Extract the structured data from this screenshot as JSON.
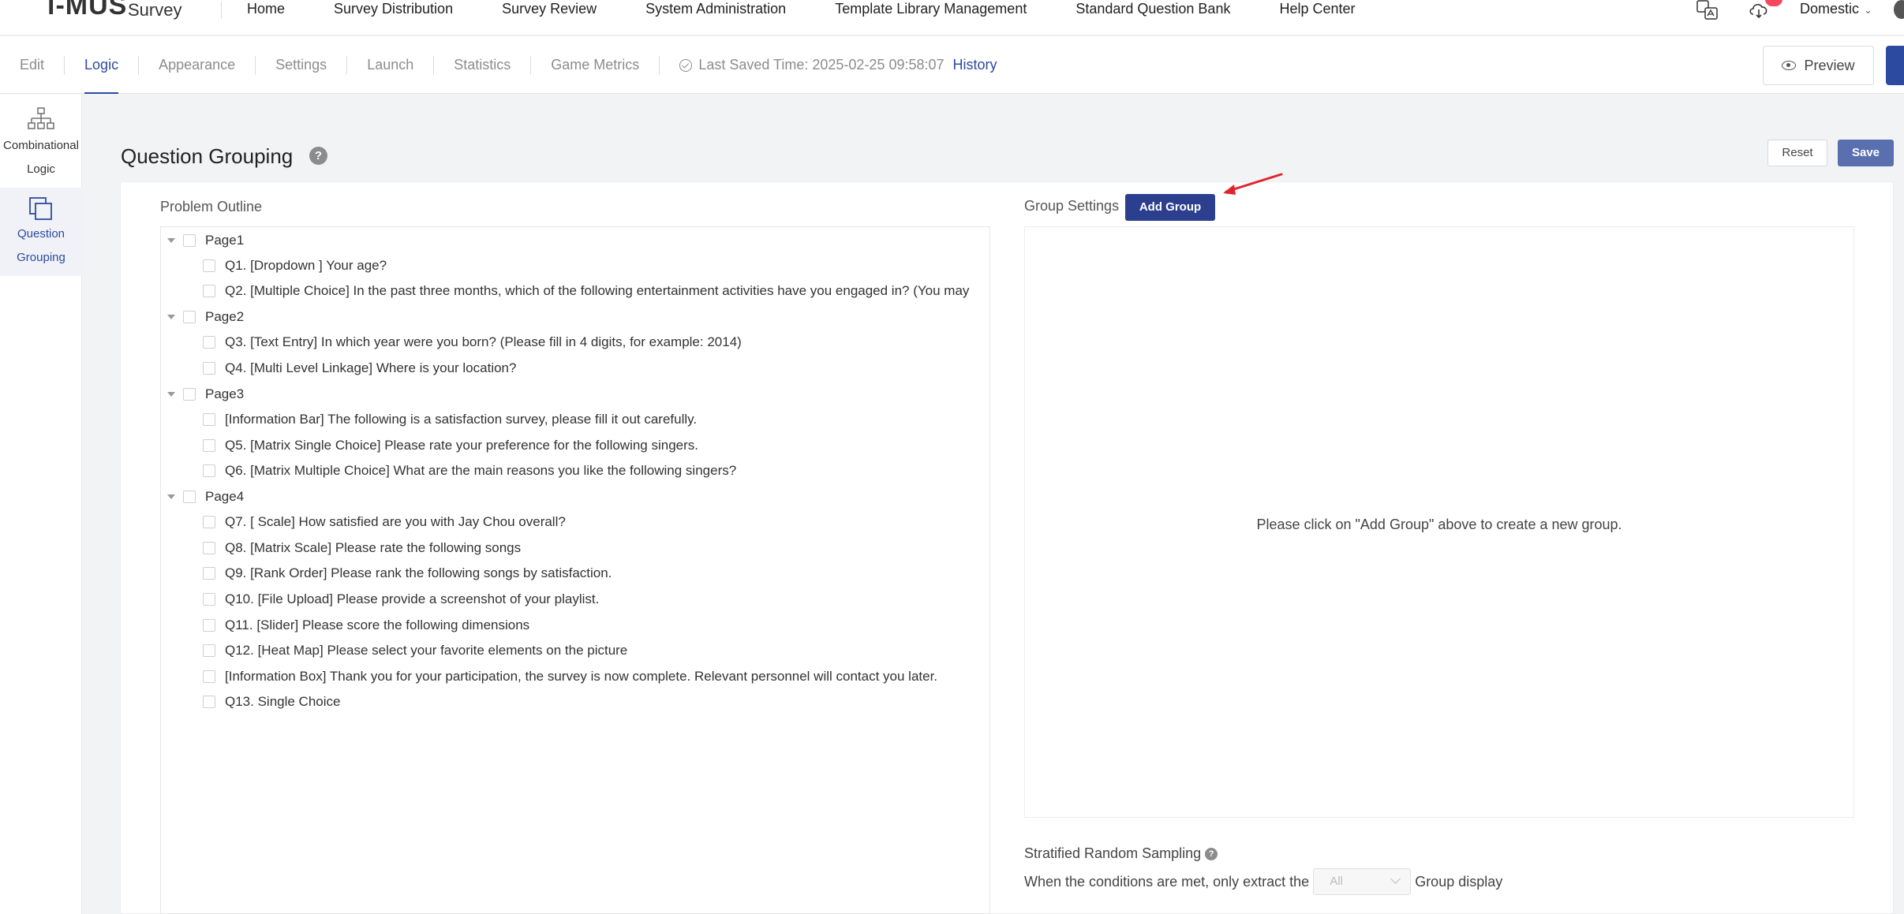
{
  "header": {
    "logo_text": "i-MUS",
    "logo_sub": "Survey",
    "nav": [
      "Home",
      "Survey Distribution",
      "Survey Review",
      "System Administration",
      "Template Library Management",
      "Standard Question Bank",
      "Help Center"
    ],
    "region": "Domestic",
    "icons": [
      "translate-icon",
      "cloud-download-icon",
      "user-avatar"
    ]
  },
  "subnav": {
    "tabs": [
      "Edit",
      "Logic",
      "Appearance",
      "Settings",
      "Launch",
      "Statistics",
      "Game Metrics"
    ],
    "active_tab": "Logic",
    "last_saved": "Last Saved Time: 2025-02-25 09:58:07",
    "history": "History",
    "preview": "Preview"
  },
  "sidebar": {
    "items": [
      {
        "label_line1": "Combinational",
        "label_line2": "Logic",
        "icon": "hierarchy-icon"
      },
      {
        "label_line1": "Question",
        "label_line2": "Grouping",
        "icon": "layers-icon"
      }
    ]
  },
  "main": {
    "title": "Question Grouping",
    "help": "?",
    "reset": "Reset",
    "save": "Save"
  },
  "outline": {
    "label": "Problem Outline",
    "pages": [
      {
        "title": "Page1",
        "questions": [
          "Q1. [Dropdown ] Your age?",
          "Q2. [Multiple Choice] In the past three months, which of the following entertainment activities have you engaged in? (You may"
        ]
      },
      {
        "title": "Page2",
        "questions": [
          "Q3. [Text Entry] In which year were you born? (Please fill in 4 digits, for example: 2014)",
          "Q4. [Multi Level Linkage] Where is your location?"
        ]
      },
      {
        "title": "Page3",
        "questions": [
          "[Information Bar] The following is a satisfaction survey, please fill it out carefully.",
          "Q5. [Matrix Single Choice] Please rate your preference for the following singers.",
          "Q6. [Matrix Multiple Choice] What are the main reasons you like the following singers?"
        ]
      },
      {
        "title": "Page4",
        "questions": [
          "Q7. [ Scale] How satisfied are you with Jay Chou overall?",
          "Q8. [Matrix Scale] Please rate the following songs",
          "Q9. [Rank Order] Please rank the following songs by satisfaction.",
          "Q10. [File Upload] Please provide a screenshot of your playlist.",
          "Q11. [Slider] Please score the following dimensions",
          "Q12. [Heat Map] Please select your favorite elements on the picture",
          "[Information Box] Thank you for your participation, the survey is now complete. Relevant personnel will contact you later.",
          "Q13. Single Choice"
        ]
      }
    ]
  },
  "group_settings": {
    "label": "Group Settings",
    "add_group": "Add Group",
    "empty_text": "Please click on \"Add Group\" above to create a new group.",
    "stratified_label": "Stratified Random Sampling",
    "condition_prefix": "When the conditions are met, only extract the",
    "select_value": "All",
    "condition_suffix": "Group display"
  },
  "colors": {
    "primary": "#2c4ba0",
    "add_group_bg": "#2c3f8f",
    "save_bg": "#5a6fb0",
    "annotation_arrow": "#e0242b"
  }
}
